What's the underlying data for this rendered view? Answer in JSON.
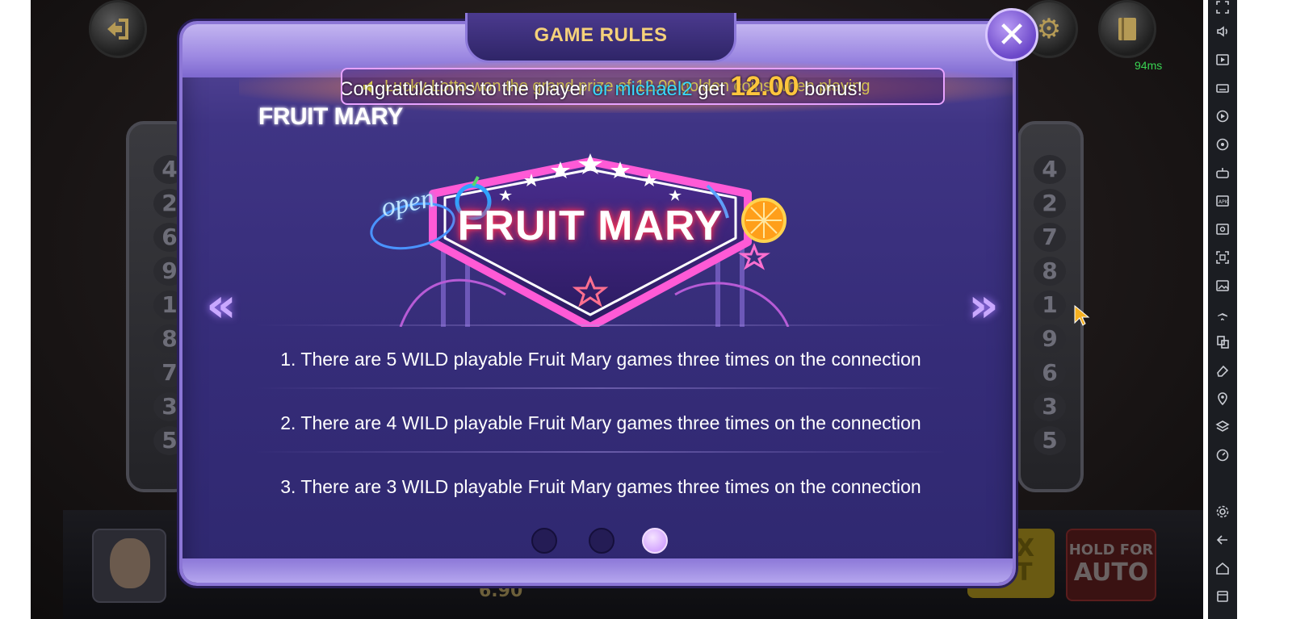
{
  "modal": {
    "title": "GAME RULES",
    "ticker": {
      "back_text": "Lucky Lotto won the grand prize of 12.00 golden coins when playing",
      "prefix": "Congratulations to the player ",
      "user": "or michael2",
      "mid": " get ",
      "amount": "12.00",
      "suffix": " bonus!"
    },
    "game_name": "FRUIT MARY",
    "sign": {
      "main_text": "FRUIT MARY",
      "open_text": "open"
    },
    "rules": [
      "1. There are 5 WILD playable Fruit Mary games three times on the connection",
      "2. There are 4 WILD playable Fruit Mary games three times on the connection",
      "3. There are 3 WILD playable Fruit Mary games three times on the connection"
    ],
    "pagination": {
      "total": 3,
      "active": 3
    },
    "prev_icon": "double-chevron-left-icon",
    "next_icon": "double-chevron-right-icon",
    "close_icon": "close-icon"
  },
  "background": {
    "ping": "94ms",
    "left_reel": [
      "4",
      "2",
      "6",
      "9",
      "1",
      "8",
      "7",
      "3",
      "5"
    ],
    "right_reel": [
      "4",
      "2",
      "7",
      "8",
      "1",
      "9",
      "6",
      "3",
      "5"
    ],
    "bottom_value": "6.90",
    "maxbet_label": "X\nT",
    "auto_button": {
      "line1": "HOLD FOR",
      "line2": "AUTO"
    }
  },
  "colors": {
    "title": "#f5d17a",
    "ticker_user": "#39d8ff",
    "ticker_amount": "#ffc53d",
    "modal_bg": "#3f3484",
    "ping": "#39d352"
  }
}
